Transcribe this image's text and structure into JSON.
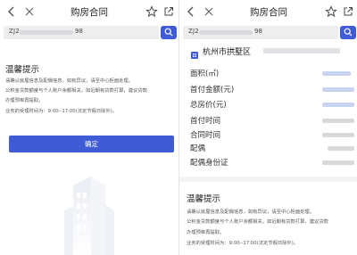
{
  "left": {
    "title": "购房合同",
    "search": {
      "prefix": "ZJ2",
      "suffix": "98"
    },
    "tips": {
      "title": "温馨提示",
      "lines": [
        "请确认房屋信息及配偶信息，如有异议，请至中心柜面处理。",
        "公积金贷款额度与个人账户余额相关，如近期有贷款打算，建议贷款",
        "办理预审再提取。",
        "业务的受理时间为：9:00--17:00(法定节假日除外)。"
      ]
    },
    "confirm_label": "确定"
  },
  "right": {
    "title": "购房合同",
    "search": {
      "prefix": "ZJ2",
      "suffix": "98"
    },
    "city": "杭州市拱墅区",
    "fields": [
      {
        "label": "面积(㎡)",
        "tone": "blue"
      },
      {
        "label": "首付金额(元)",
        "tone": "blue"
      },
      {
        "label": "总房价(元)",
        "tone": "blue"
      },
      {
        "label": "首付时间",
        "tone": "gray"
      },
      {
        "label": "合同时间",
        "tone": "gray"
      },
      {
        "label": "配偶",
        "tone": "gray"
      },
      {
        "label": "配偶身份证",
        "tone": "gray"
      }
    ],
    "tips": {
      "title": "温馨提示",
      "lines": [
        "请确认房屋信息及配偶信息，如有异议，请至中心柜面处理。",
        "公积金贷款额度与个人账户余额相关，如近期有贷款打算，建议贷款",
        "办理预审再提取。",
        "业务的受理时间为：9:00--17:00(法定节假日除外)。"
      ]
    }
  },
  "icons": [
    "back-icon",
    "close-icon",
    "star-icon",
    "share-icon",
    "search-icon",
    "building-icon"
  ],
  "colors": {
    "accent": "#3f5bd6",
    "value_placeholder": "#c9d4f1"
  }
}
